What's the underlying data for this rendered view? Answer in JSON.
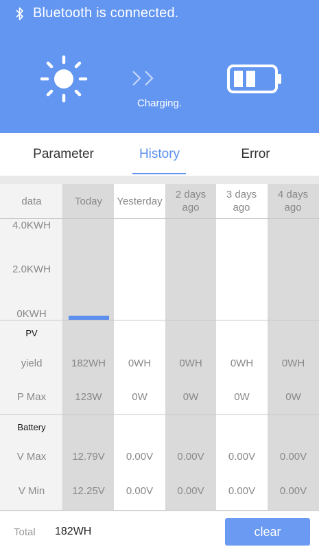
{
  "status": {
    "bluetooth_text": "Bluetooth is connected.",
    "charging_text": "Charging."
  },
  "tabs": [
    {
      "label": "Parameter"
    },
    {
      "label": "History"
    },
    {
      "label": "Error"
    }
  ],
  "active_tab": "History",
  "table": {
    "header": {
      "label": "data",
      "columns": [
        "Today",
        "Yesterday",
        "2 days ago",
        "3 days ago",
        "4 days ago"
      ]
    },
    "chart_axis": [
      "4.0KWH",
      "2.0KWH",
      "0KWH"
    ],
    "today_bar_value_wh": 182,
    "pv": {
      "title": "PV",
      "rows": [
        {
          "label": "yield",
          "values": [
            "182WH",
            "0WH",
            "0WH",
            "0WH",
            "0WH"
          ]
        },
        {
          "label": "P Max",
          "values": [
            "123W",
            "0W",
            "0W",
            "0W",
            "0W"
          ]
        }
      ]
    },
    "battery": {
      "title": "Battery",
      "rows": [
        {
          "label": "V Max",
          "values": [
            "12.79V",
            "0.00V",
            "0.00V",
            "0.00V",
            "0.00V"
          ]
        },
        {
          "label": "V Min",
          "values": [
            "12.25V",
            "0.00V",
            "0.00V",
            "0.00V",
            "0.00V"
          ]
        }
      ]
    }
  },
  "footer": {
    "total_label": "Total",
    "total_value": "182WH",
    "clear_label": "clear"
  },
  "colors": {
    "accent": "#6396f1",
    "column_shade": "#dadada"
  }
}
